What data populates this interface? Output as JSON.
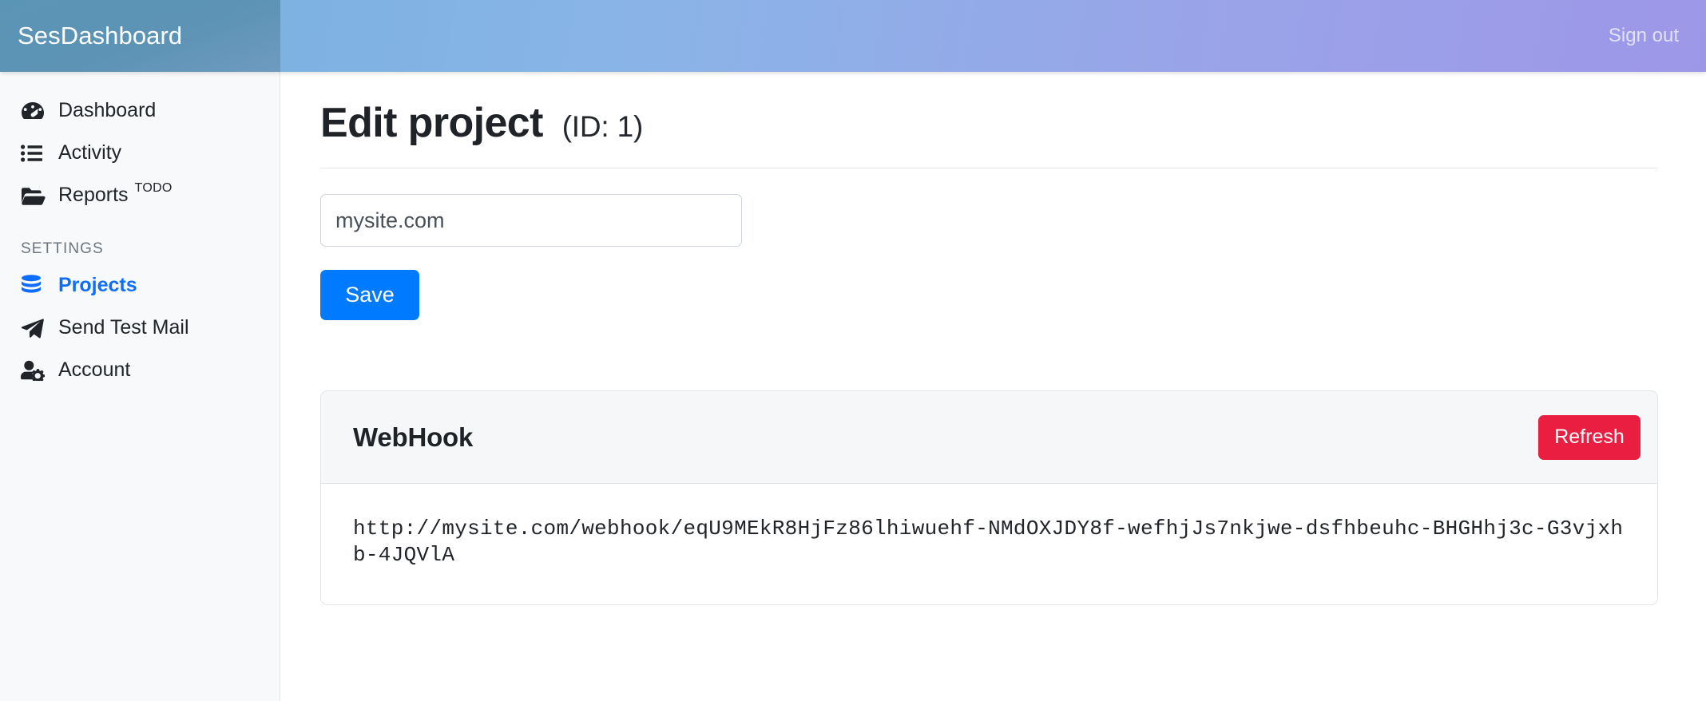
{
  "navbar": {
    "brand": "SesDashboard",
    "signout_label": "Sign out"
  },
  "sidebar": {
    "items": [
      {
        "label": "Dashboard",
        "icon": "speedometer-icon",
        "badge": "",
        "active": false
      },
      {
        "label": "Activity",
        "icon": "list-icon",
        "badge": "",
        "active": false
      },
      {
        "label": "Reports",
        "icon": "folder-open-icon",
        "badge": "TODO",
        "active": false
      }
    ],
    "section_label": "SETTINGS",
    "settings_items": [
      {
        "label": "Projects",
        "icon": "database-icon",
        "badge": "",
        "active": true
      },
      {
        "label": "Send Test Mail",
        "icon": "paper-plane-icon",
        "badge": "",
        "active": false
      },
      {
        "label": "Account",
        "icon": "user-gear-icon",
        "badge": "",
        "active": false
      }
    ]
  },
  "page": {
    "title": "Edit project",
    "id_suffix": "(ID: 1)"
  },
  "form": {
    "project_name_value": "mysite.com",
    "project_name_placeholder": "mysite.com",
    "save_label": "Save"
  },
  "webhook": {
    "card_title": "WebHook",
    "refresh_label": "Refresh",
    "url": "http://mysite.com/webhook/eqU9MEkR8HjFz86lhiwuehf-NMdOXJDY8f-wefhjJs7nkjwe-dsfhbeuhc-BHGHhj3c-G3vjxhb-4JQVlA"
  },
  "colors": {
    "brand_bg": "#5d93b5",
    "navbar_start": "#74b0dd",
    "navbar_end": "#9d97e8",
    "accent_blue": "#007bff",
    "danger_red": "#e91e41",
    "sidebar_bg": "#f8f9fa",
    "active_link": "#0d6efd"
  }
}
